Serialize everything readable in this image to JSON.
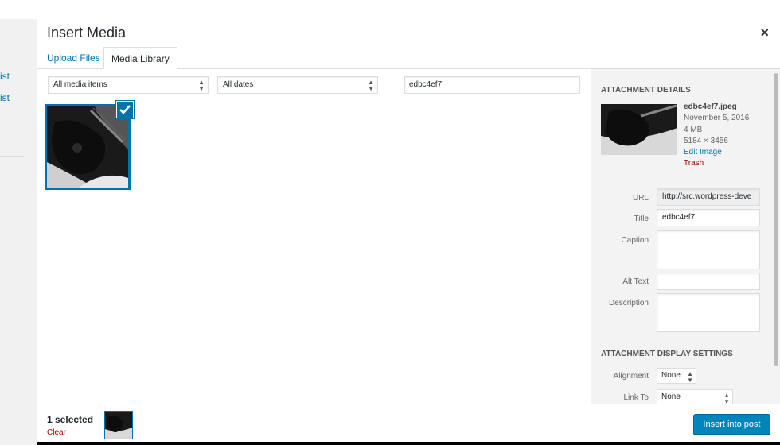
{
  "background": {
    "links": [
      "ist",
      "ist"
    ]
  },
  "modal": {
    "title": "Insert Media",
    "close_glyph": "×",
    "tabs": [
      {
        "label": "Upload Files",
        "active": false
      },
      {
        "label": "Media Library",
        "active": true
      }
    ]
  },
  "filters": {
    "media_type": {
      "selected": "All media items"
    },
    "date": {
      "selected": "All dates"
    },
    "search_value": "edbc4ef7"
  },
  "grid": {
    "items": [
      {
        "checked": true,
        "check_glyph": "✓"
      }
    ]
  },
  "details": {
    "heading": "Attachment Details",
    "filename": "edbc4ef7.jpeg",
    "date": "November 5, 2016",
    "size": "4 MB",
    "dimensions": "5184 × 3456",
    "edit_label": "Edit Image",
    "trash_label": "Trash",
    "fields": {
      "url_label": "URL",
      "url_value": "http://src.wordpress-deve",
      "title_label": "Title",
      "title_value": "edbc4ef7",
      "caption_label": "Caption",
      "caption_value": "",
      "alt_label": "Alt Text",
      "alt_value": "",
      "description_label": "Description",
      "description_value": ""
    }
  },
  "display_settings": {
    "heading": "Attachment Display Settings",
    "alignment_label": "Alignment",
    "alignment_value": "None",
    "link_label": "Link To",
    "link_value": "None"
  },
  "toolbar": {
    "selected_text": "1 selected",
    "clear_label": "Clear",
    "insert_label": "Insert into post"
  },
  "colors": {
    "accent": "#0073aa",
    "button": "#0085ba",
    "danger": "#a00"
  }
}
